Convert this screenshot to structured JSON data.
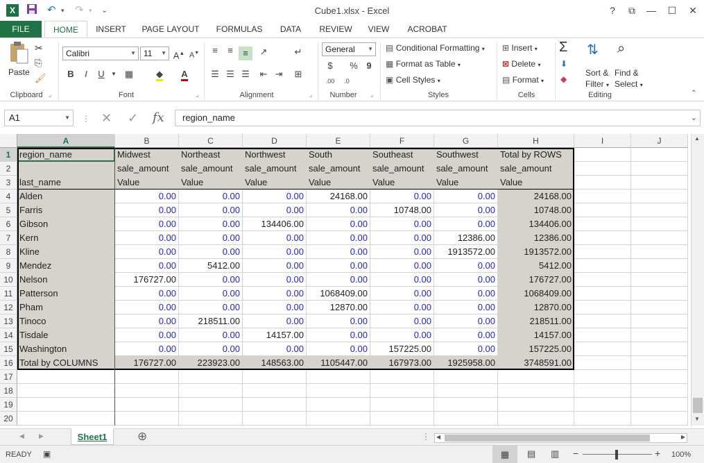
{
  "window": {
    "title": "Cube1.xlsx - Excel",
    "help": "?",
    "restore_ribbon": "⧉",
    "minimize": "—",
    "maximize": "☐",
    "close": "✕"
  },
  "quick_access": {
    "undo": "↶",
    "redo": "↷",
    "more": "⌄"
  },
  "ribbon_tabs": [
    "FILE",
    "HOME",
    "INSERT",
    "PAGE LAYOUT",
    "FORMULAS",
    "DATA",
    "REVIEW",
    "VIEW",
    "ACROBAT"
  ],
  "ribbon": {
    "clipboard": {
      "label": "Clipboard",
      "paste": "Paste"
    },
    "font": {
      "label": "Font",
      "name": "Calibri",
      "size": "11",
      "bold": "B",
      "italic": "I",
      "underline": "U"
    },
    "alignment": {
      "label": "Alignment"
    },
    "number": {
      "label": "Number",
      "format": "General",
      "currency": "$",
      "percent": "%",
      "comma": "9"
    },
    "styles": {
      "label": "Styles",
      "conditional": "Conditional Formatting",
      "format_table": "Format as Table",
      "cell_styles": "Cell Styles"
    },
    "cells": {
      "label": "Cells",
      "insert": "Insert",
      "delete": "Delete",
      "format": "Format"
    },
    "editing": {
      "label": "Editing",
      "sort_1": "Sort &",
      "sort_2": "Filter",
      "find_1": "Find &",
      "find_2": "Select"
    }
  },
  "formula_bar": {
    "name_box": "A1",
    "fx": "fx",
    "value": "region_name"
  },
  "columns": [
    "A",
    "B",
    "C",
    "D",
    "E",
    "F",
    "G",
    "H",
    "I",
    "J"
  ],
  "rows": [
    {
      "n": "1",
      "cells": [
        "region_name",
        "Midwest",
        "Northeast",
        "Northwest",
        "South",
        "Southeast",
        "Southwest",
        "Total by ROWS"
      ]
    },
    {
      "n": "2",
      "cells": [
        "",
        "sale_amount",
        "sale_amount",
        "sale_amount",
        "sale_amount",
        "sale_amount",
        "sale_amount",
        "sale_amount"
      ]
    },
    {
      "n": "3",
      "cells": [
        "last_name",
        "Value",
        "Value",
        "Value",
        "Value",
        "Value",
        "Value",
        "Value"
      ]
    },
    {
      "n": "4",
      "cells": [
        "Alden",
        "0.00",
        "0.00",
        "0.00",
        "24168.00",
        "0.00",
        "0.00",
        "24168.00"
      ]
    },
    {
      "n": "5",
      "cells": [
        "Farris",
        "0.00",
        "0.00",
        "0.00",
        "0.00",
        "10748.00",
        "0.00",
        "10748.00"
      ]
    },
    {
      "n": "6",
      "cells": [
        "Gibson",
        "0.00",
        "0.00",
        "134406.00",
        "0.00",
        "0.00",
        "0.00",
        "134406.00"
      ]
    },
    {
      "n": "7",
      "cells": [
        "Kern",
        "0.00",
        "0.00",
        "0.00",
        "0.00",
        "0.00",
        "12386.00",
        "12386.00"
      ]
    },
    {
      "n": "8",
      "cells": [
        "Kline",
        "0.00",
        "0.00",
        "0.00",
        "0.00",
        "0.00",
        "1913572.00",
        "1913572.00"
      ]
    },
    {
      "n": "9",
      "cells": [
        "Mendez",
        "0.00",
        "5412.00",
        "0.00",
        "0.00",
        "0.00",
        "0.00",
        "5412.00"
      ]
    },
    {
      "n": "10",
      "cells": [
        "Nelson",
        "176727.00",
        "0.00",
        "0.00",
        "0.00",
        "0.00",
        "0.00",
        "176727.00"
      ]
    },
    {
      "n": "11",
      "cells": [
        "Patterson",
        "0.00",
        "0.00",
        "0.00",
        "1068409.00",
        "0.00",
        "0.00",
        "1068409.00"
      ]
    },
    {
      "n": "12",
      "cells": [
        "Pham",
        "0.00",
        "0.00",
        "0.00",
        "12870.00",
        "0.00",
        "0.00",
        "12870.00"
      ]
    },
    {
      "n": "13",
      "cells": [
        "Tinoco",
        "0.00",
        "218511.00",
        "0.00",
        "0.00",
        "0.00",
        "0.00",
        "218511.00"
      ]
    },
    {
      "n": "14",
      "cells": [
        "Tisdale",
        "0.00",
        "0.00",
        "14157.00",
        "0.00",
        "0.00",
        "0.00",
        "14157.00"
      ]
    },
    {
      "n": "15",
      "cells": [
        "Washington",
        "0.00",
        "0.00",
        "0.00",
        "0.00",
        "157225.00",
        "0.00",
        "157225.00"
      ]
    },
    {
      "n": "16",
      "cells": [
        "Total by COLUMNS",
        "176727.00",
        "223923.00",
        "148563.00",
        "1105447.00",
        "167973.00",
        "1925958.00",
        "3748591.00"
      ]
    },
    {
      "n": "17",
      "cells": []
    },
    {
      "n": "18",
      "cells": []
    },
    {
      "n": "19",
      "cells": []
    },
    {
      "n": "20",
      "cells": []
    }
  ],
  "sheet_tab": "Sheet1",
  "add_sheet": "⊕",
  "status": {
    "mode": "READY",
    "zoom_minus": "−",
    "zoom_plus": "+",
    "zoom": "100%"
  },
  "colors": {
    "accent": "#217346",
    "zero_value": "#1f1fd0",
    "pivot_fill": "#d6d2cc"
  }
}
